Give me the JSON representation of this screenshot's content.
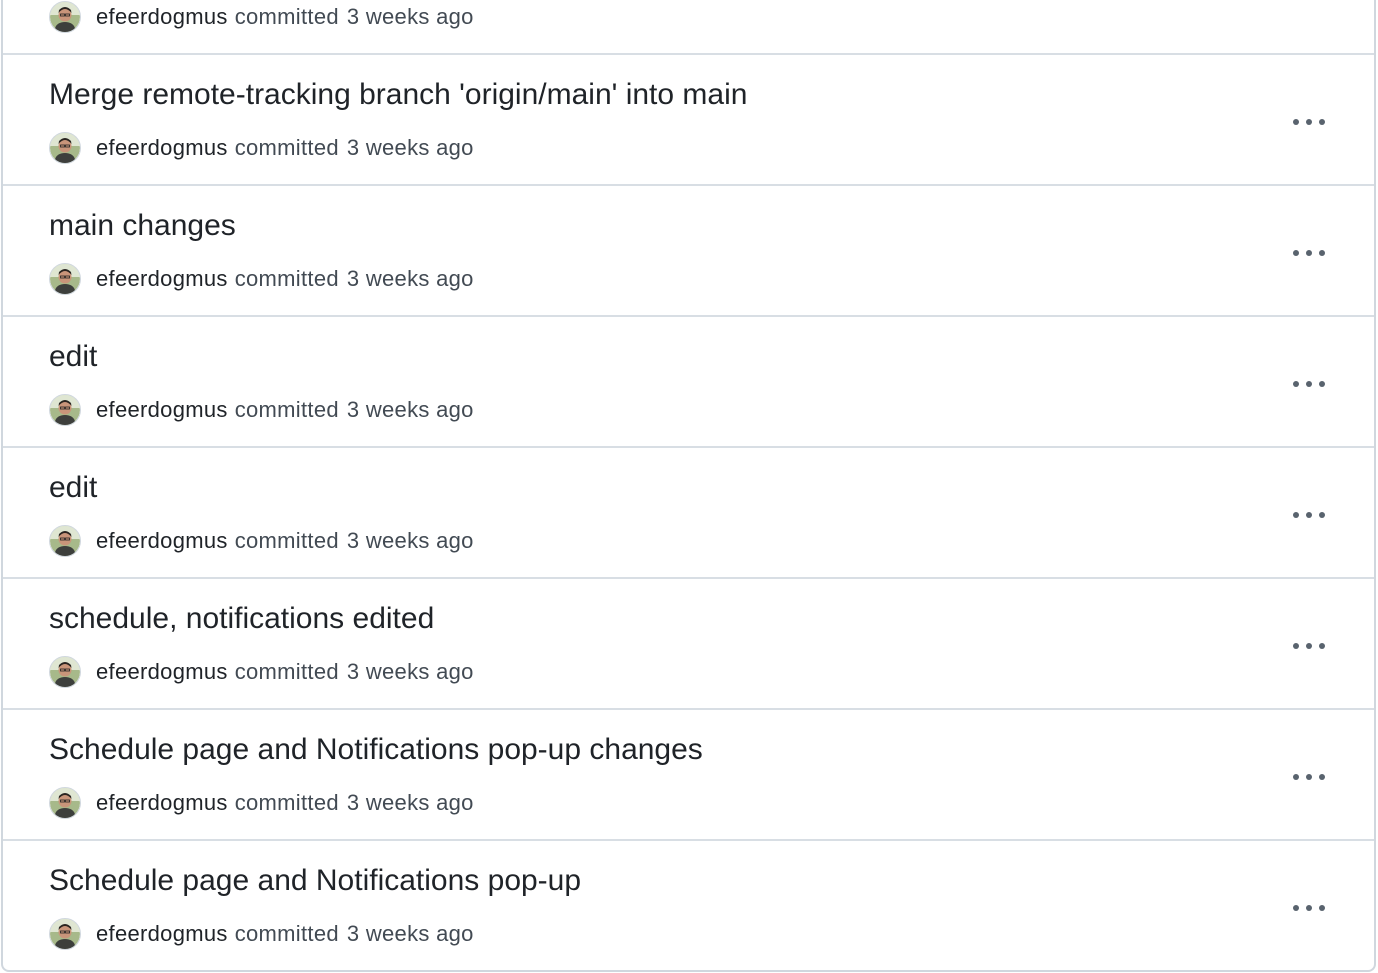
{
  "commits": [
    {
      "title": "",
      "author": "efeerdogmus",
      "action": "committed",
      "time": "3 weeks ago"
    },
    {
      "title": "Merge remote-tracking branch 'origin/main' into main",
      "author": "efeerdogmus",
      "action": "committed",
      "time": "3 weeks ago"
    },
    {
      "title": "main changes",
      "author": "efeerdogmus",
      "action": "committed",
      "time": "3 weeks ago"
    },
    {
      "title": "edit",
      "author": "efeerdogmus",
      "action": "committed",
      "time": "3 weeks ago"
    },
    {
      "title": "edit",
      "author": "efeerdogmus",
      "action": "committed",
      "time": "3 weeks ago"
    },
    {
      "title": "schedule, notifications edited",
      "author": "efeerdogmus",
      "action": "committed",
      "time": "3 weeks ago"
    },
    {
      "title": "Schedule page and Notifications pop-up changes",
      "author": "efeerdogmus",
      "action": "committed",
      "time": "3 weeks ago"
    },
    {
      "title": "Schedule page and Notifications pop-up",
      "author": "efeerdogmus",
      "action": "committed",
      "time": "3 weeks ago"
    }
  ],
  "icons": {
    "avatar": "avatar-photo",
    "more": "kebab-horizontal-icon"
  },
  "colors": {
    "text": "#1f2328",
    "muted": "#424a53",
    "border": "#d0d7de",
    "icon": "#59636e"
  }
}
